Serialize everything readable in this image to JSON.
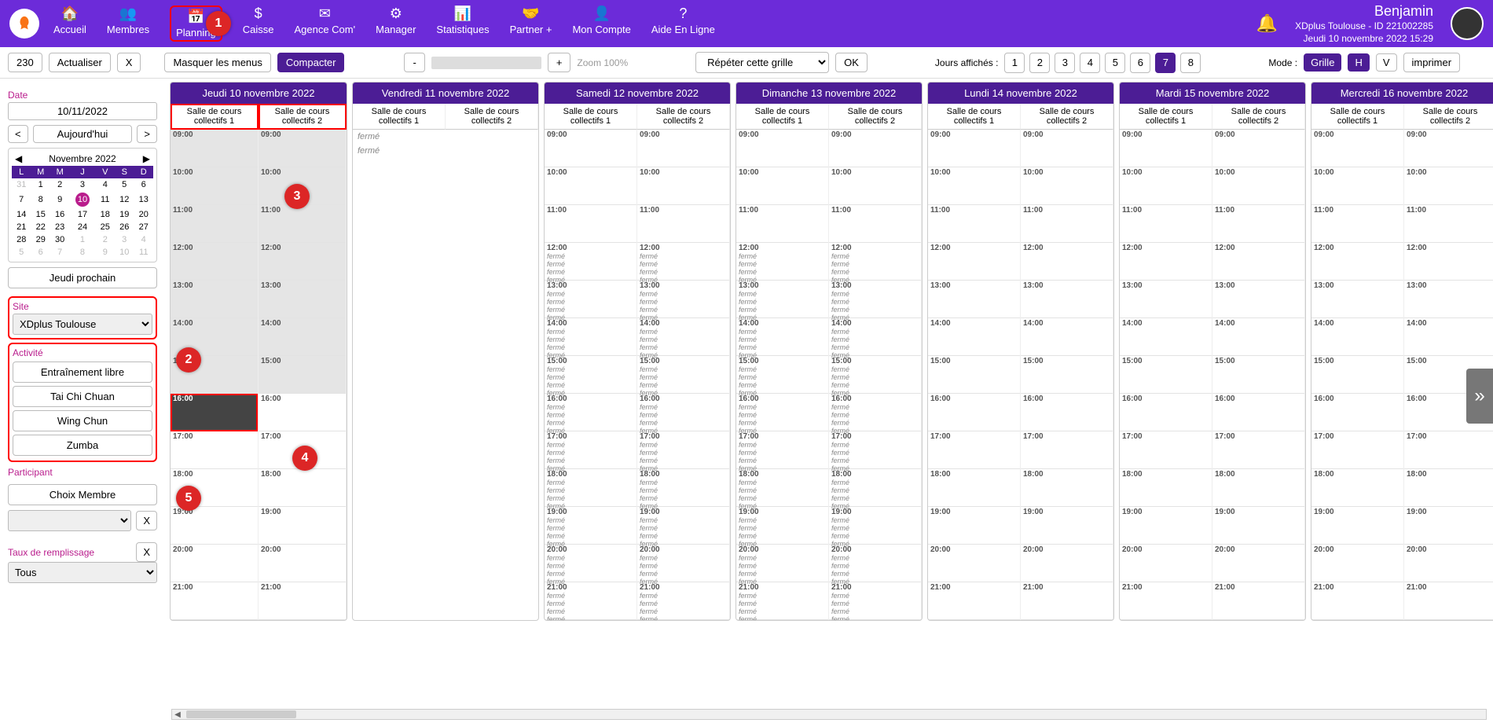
{
  "nav": {
    "items": [
      {
        "icon": "🏠",
        "label": "Accueil"
      },
      {
        "icon": "👥",
        "label": "Membres"
      },
      {
        "icon": "📅",
        "label": "Planning"
      },
      {
        "icon": "$",
        "label": "Caisse"
      },
      {
        "icon": "✉",
        "label": "Agence Com'"
      },
      {
        "icon": "⚙",
        "label": "Manager"
      },
      {
        "icon": "📊",
        "label": "Statistiques"
      },
      {
        "icon": "🤝",
        "label": "Partner +"
      },
      {
        "icon": "👤",
        "label": "Mon Compte"
      },
      {
        "icon": "?",
        "label": "Aide En Ligne"
      }
    ]
  },
  "user": {
    "name": "Benjamin",
    "org": "XDplus Toulouse - ID 221002285",
    "datetime": "Jeudi 10 novembre 2022 15:29"
  },
  "toolbar": {
    "count": "230",
    "refresh": "Actualiser",
    "x": "X",
    "hideMenus": "Masquer les menus",
    "compact": "Compacter",
    "minus": "-",
    "plus": "+",
    "zoom": "Zoom 100%",
    "repeat": "Répéter cette grille",
    "ok": "OK",
    "daysLabel": "Jours affichés :",
    "days": [
      "1",
      "2",
      "3",
      "4",
      "5",
      "6",
      "7",
      "8"
    ],
    "daysActive": "7",
    "modeLabel": "Mode :",
    "modes": [
      "Grille",
      "H",
      "V"
    ],
    "print": "imprimer"
  },
  "sidebar": {
    "dateLabel": "Date",
    "dateValue": "10/11/2022",
    "prev": "<",
    "today": "Aujourd'hui",
    "next": ">",
    "mcPrev": "◀",
    "mcNext": "▶",
    "monthLabel": "Novembre  2022",
    "dow": [
      "L",
      "M",
      "M",
      "J",
      "V",
      "S",
      "D"
    ],
    "weeks": [
      [
        "31",
        "1",
        "2",
        "3",
        "4",
        "5",
        "6"
      ],
      [
        "7",
        "8",
        "9",
        "10",
        "11",
        "12",
        "13"
      ],
      [
        "14",
        "15",
        "16",
        "17",
        "18",
        "19",
        "20"
      ],
      [
        "21",
        "22",
        "23",
        "24",
        "25",
        "26",
        "27"
      ],
      [
        "28",
        "29",
        "30",
        "1",
        "2",
        "3",
        "4"
      ],
      [
        "5",
        "6",
        "7",
        "8",
        "9",
        "10",
        "11"
      ]
    ],
    "selDay": "10",
    "jeudiProchain": "Jeudi prochain",
    "siteLabel": "Site",
    "siteValue": "XDplus Toulouse",
    "activityLabel": "Activité",
    "activities": [
      "Entraînement libre",
      "Tai Chi Chuan",
      "Wing Chun",
      "Zumba"
    ],
    "participantLabel": "Participant",
    "choixMembre": "Choix Membre",
    "tauxLabel": "Taux de remplissage",
    "tauxValue": "Tous",
    "clear": "X"
  },
  "calendar": {
    "room1": "Salle de cours collectifs 1",
    "room2": "Salle de cours collectifs 2",
    "ferme": "fermé",
    "hours": [
      "09:00",
      "10:00",
      "11:00",
      "12:00",
      "13:00",
      "14:00",
      "15:00",
      "16:00",
      "17:00",
      "18:00",
      "19:00",
      "20:00",
      "21:00"
    ],
    "days": [
      {
        "label": "Jeudi 10 novembre 2022",
        "today": true,
        "closed": false
      },
      {
        "label": "Vendredi 11 novembre 2022",
        "today": false,
        "closed": true
      },
      {
        "label": "Samedi 12 novembre 2022",
        "today": false,
        "closed": false,
        "fermeHours": true
      },
      {
        "label": "Dimanche 13 novembre 2022",
        "today": false,
        "closed": false,
        "fermeHours": true
      },
      {
        "label": "Lundi 14 novembre 2022",
        "today": false,
        "closed": false
      },
      {
        "label": "Mardi 15 novembre 2022",
        "today": false,
        "closed": false
      },
      {
        "label": "Mercredi 16 novembre 2022",
        "today": false,
        "closed": false
      }
    ]
  },
  "annotations": {
    "a1": "1",
    "a2": "2",
    "a3": "3",
    "a4": "4",
    "a5": "5"
  }
}
